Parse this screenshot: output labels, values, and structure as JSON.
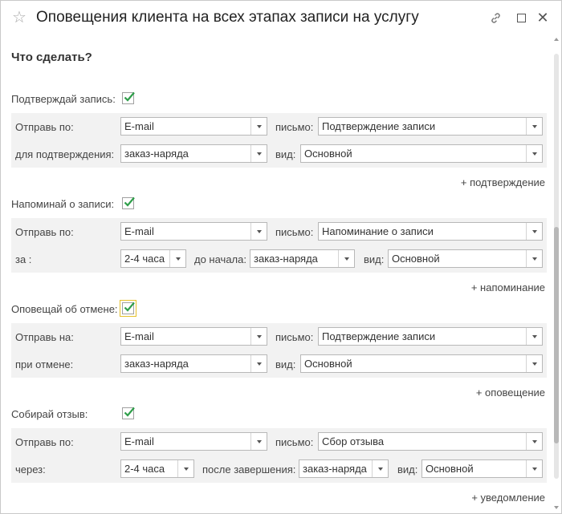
{
  "window": {
    "title": "Оповещения клиента на всех этапах записи на услугу"
  },
  "heading": "Что сделать?",
  "sections": {
    "confirm": {
      "label": "Подтверждай запись:",
      "checked": true,
      "row1": {
        "label": "Отправь по:",
        "channel": "E-mail",
        "letter_label": "письмо:",
        "letter": "Подтверждение записи"
      },
      "row2": {
        "label": "для подтверждения:",
        "doc": "заказ-наряда",
        "kind_label": "вид:",
        "kind": "Основной"
      },
      "add_link": "+ подтверждение"
    },
    "remind": {
      "label": "Напоминай о записи:",
      "checked": true,
      "row1": {
        "label": "Отправь по:",
        "channel": "E-mail",
        "letter_label": "письмо:",
        "letter": "Напоминание о записи"
      },
      "row2": {
        "label": "за :",
        "period": "2-4 часа",
        "before_label": "до начала:",
        "doc": "заказ-наряда",
        "kind_label": "вид:",
        "kind": "Основной"
      },
      "add_link": "+ напоминание"
    },
    "cancel": {
      "label": "Оповещай об отмене:",
      "checked": true,
      "row1": {
        "label": "Отправь на:",
        "channel": "E-mail",
        "letter_label": "письмо:",
        "letter": "Подтверждение записи"
      },
      "row2": {
        "label": "при отмене:",
        "doc": "заказ-наряда",
        "kind_label": "вид:",
        "kind": "Основной"
      },
      "add_link": "+ оповещение"
    },
    "feedback": {
      "label": "Собирай отзыв:",
      "checked": true,
      "row1": {
        "label": "Отправь по:",
        "channel": "E-mail",
        "letter_label": "письмо:",
        "letter": "Сбор отзыва"
      },
      "row2": {
        "label": "через:",
        "period": "2-4 часа",
        "after_label": "после завершения:",
        "doc": "заказ-наряда",
        "kind_label": "вид:",
        "kind": "Основной"
      },
      "add_link": "+ уведомление"
    }
  },
  "colors": {
    "check": "#2e9e4a",
    "focus": "#e5c02a",
    "panel": "#f2f2f2"
  }
}
